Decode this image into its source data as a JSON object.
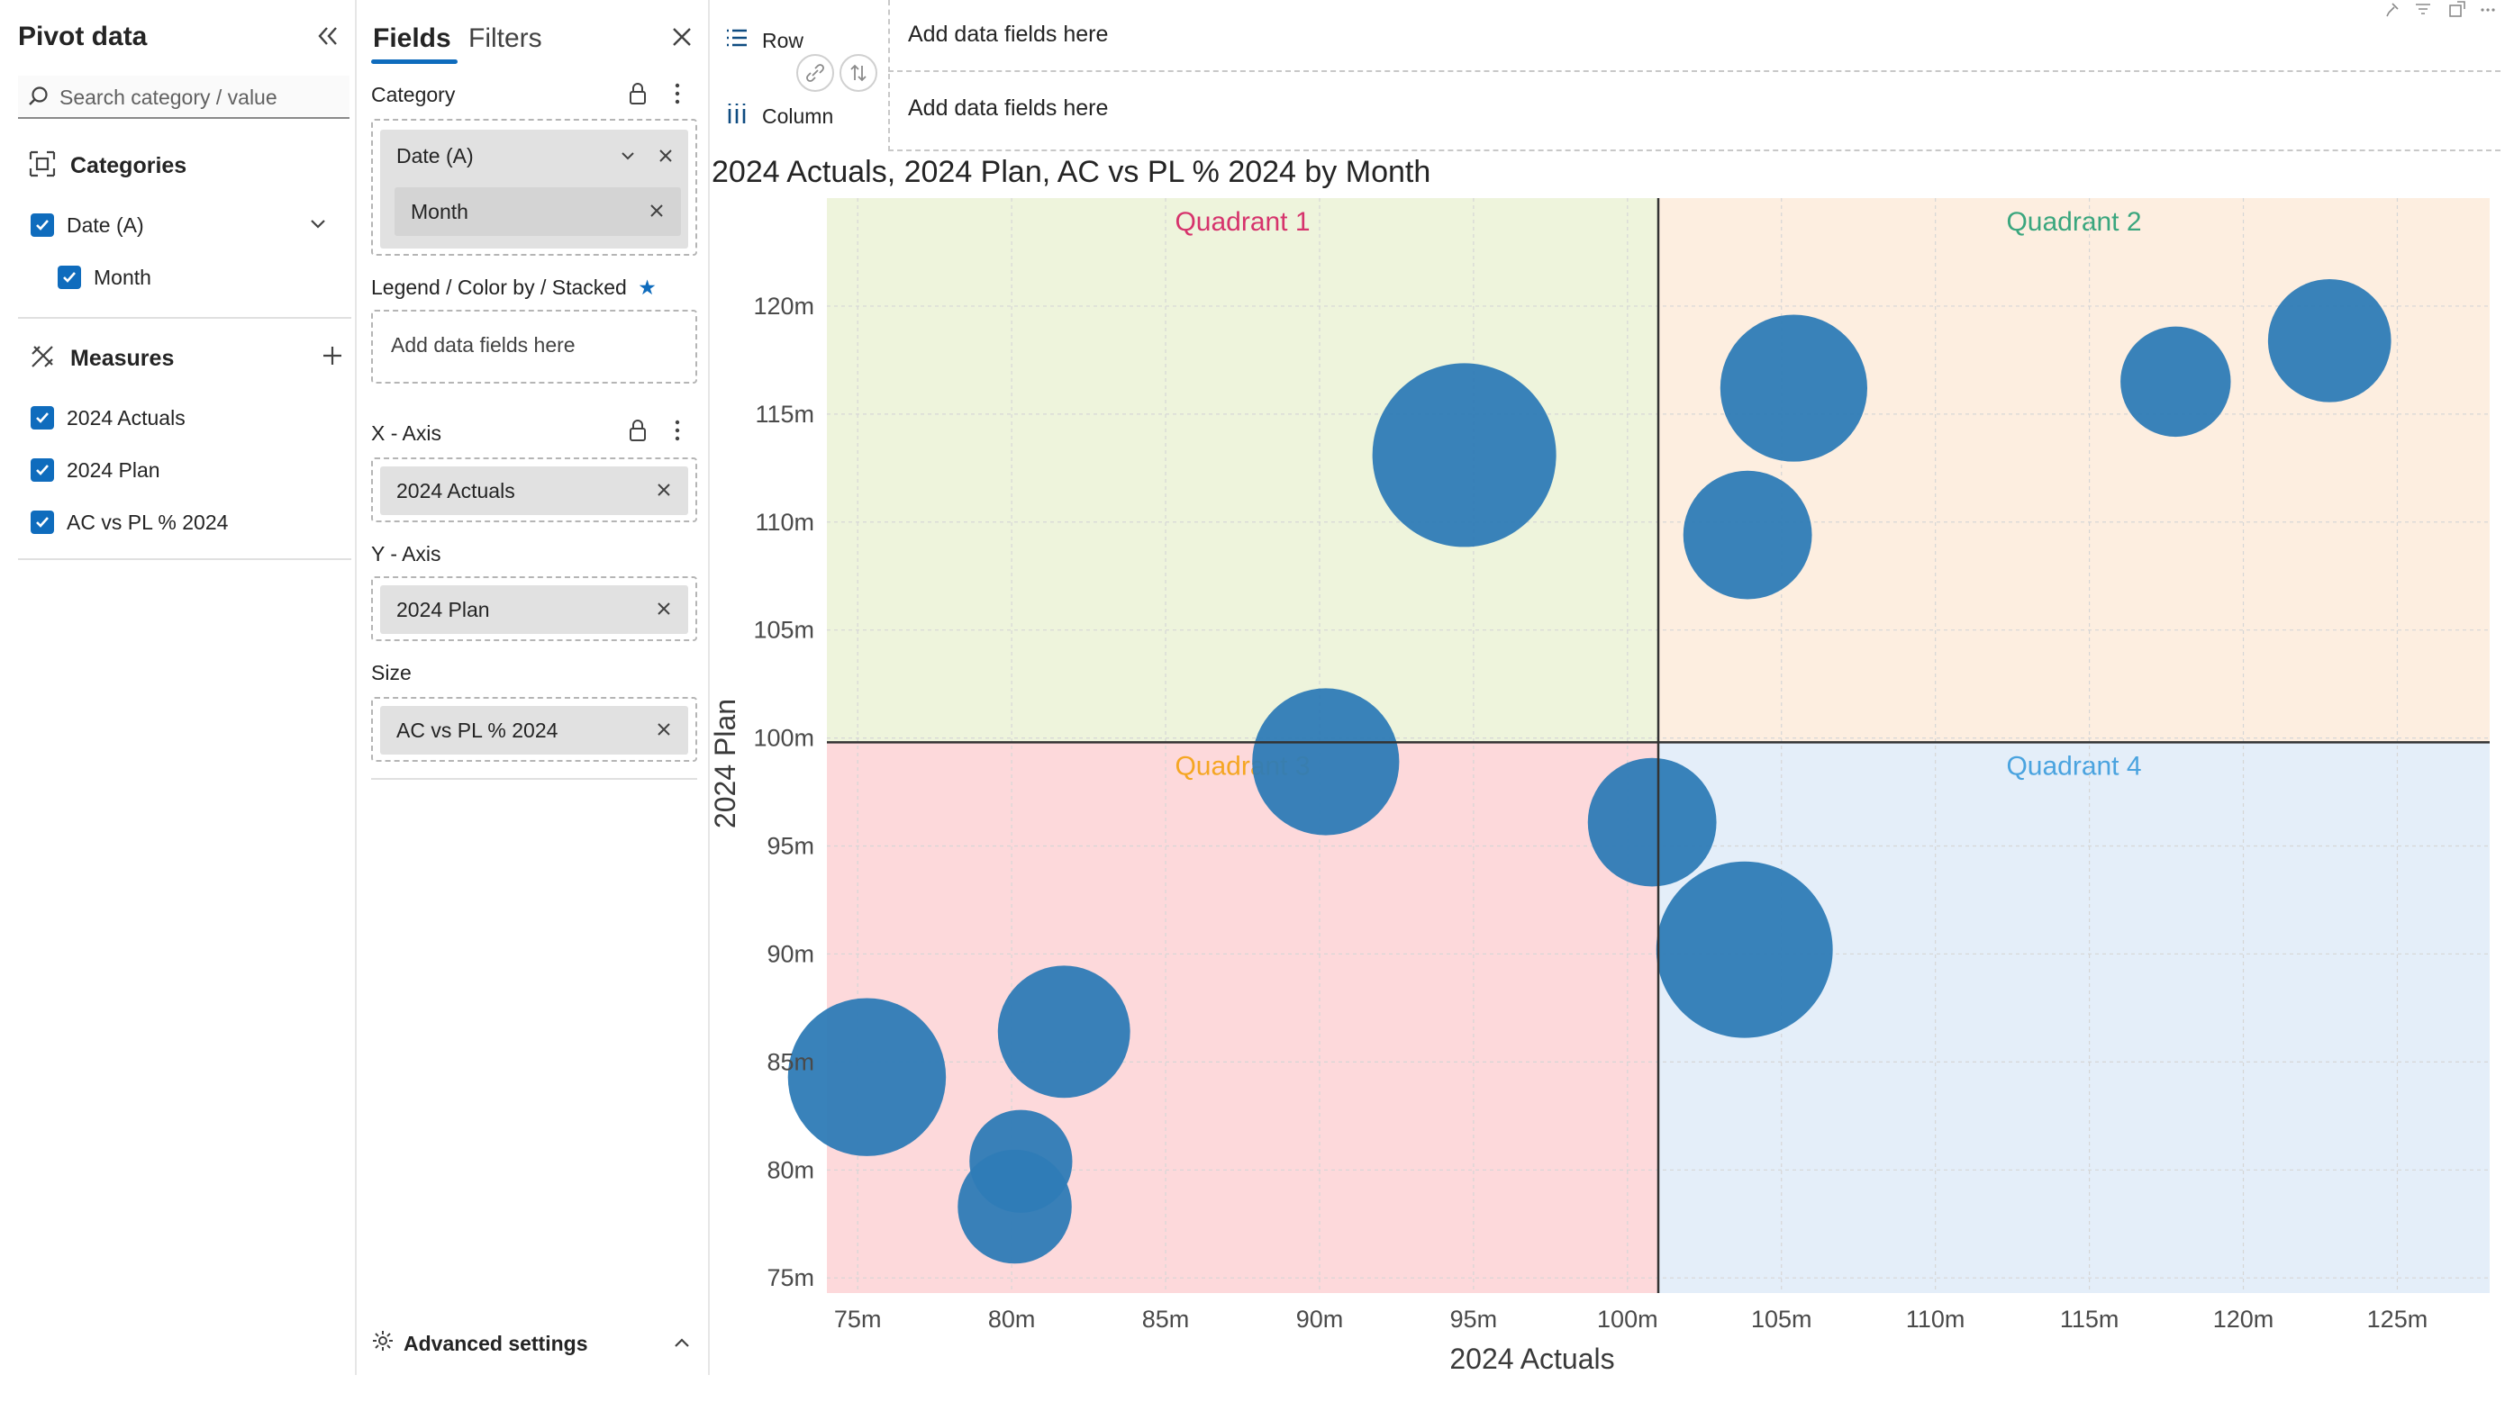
{
  "pivot": {
    "title": "Pivot data",
    "search_placeholder": "Search category / value",
    "categories_label": "Categories",
    "categories": [
      {
        "label": "Date (A)",
        "checked": true
      },
      {
        "label": "Month",
        "checked": true
      }
    ],
    "measures_label": "Measures",
    "measures": [
      {
        "label": "2024 Actuals",
        "checked": true
      },
      {
        "label": "2024 Plan",
        "checked": true
      },
      {
        "label": "AC vs PL % 2024",
        "checked": true
      }
    ]
  },
  "fields": {
    "tabs": [
      "Fields",
      "Filters"
    ],
    "category_label": "Category",
    "category_chip": "Date (A)",
    "category_subchip": "Month",
    "legend_label": "Legend / Color by / Stacked",
    "legend_placeholder": "Add data fields here",
    "xaxis_label": "X - Axis",
    "xaxis_chip": "2024 Actuals",
    "yaxis_label": "Y - Axis",
    "yaxis_chip": "2024 Plan",
    "size_label": "Size",
    "size_chip": "AC vs PL % 2024",
    "advanced_label": "Advanced settings"
  },
  "rowcol": {
    "row_label": "Row",
    "column_label": "Column",
    "row_placeholder": "Add data fields here",
    "column_placeholder": "Add data fields here"
  },
  "colors": {
    "accent": "#0f6cbd",
    "bubble": "#2e7bb6",
    "q1_bg": "#eef4dc",
    "q2_bg": "#fdeee0",
    "q3_bg": "#fdd9db",
    "q4_bg": "#e4eef9",
    "q1_label": "#d6336c",
    "q2_label": "#3aa67e",
    "q3_label": "#f5a623",
    "q4_label": "#4aa3df"
  },
  "chart_data": {
    "type": "scatter",
    "title": "2024 Actuals, 2024 Plan, AC vs PL % 2024 by Month",
    "xlabel": "2024 Actuals",
    "ylabel": "2024 Plan",
    "xlim": [
      74,
      128
    ],
    "ylim": [
      74.3,
      125
    ],
    "xticks": [
      {
        "value": 75,
        "label": "75m"
      },
      {
        "value": 80,
        "label": "80m"
      },
      {
        "value": 85,
        "label": "85m"
      },
      {
        "value": 90,
        "label": "90m"
      },
      {
        "value": 95,
        "label": "95m"
      },
      {
        "value": 100,
        "label": "100m"
      },
      {
        "value": 105,
        "label": "105m"
      },
      {
        "value": 110,
        "label": "110m"
      },
      {
        "value": 115,
        "label": "115m"
      },
      {
        "value": 120,
        "label": "120m"
      },
      {
        "value": 125,
        "label": "125m"
      }
    ],
    "yticks": [
      {
        "value": 75,
        "label": "75m"
      },
      {
        "value": 80,
        "label": "80m"
      },
      {
        "value": 85,
        "label": "85m"
      },
      {
        "value": 90,
        "label": "90m"
      },
      {
        "value": 95,
        "label": "95m"
      },
      {
        "value": 100,
        "label": "100m"
      },
      {
        "value": 105,
        "label": "105m"
      },
      {
        "value": 110,
        "label": "110m"
      },
      {
        "value": 115,
        "label": "115m"
      },
      {
        "value": 120,
        "label": "120m"
      }
    ],
    "quadrant_divider": {
      "x": 101,
      "y": 99.8
    },
    "quadrants": [
      "Quadrant 1",
      "Quadrant 2",
      "Quadrant 3",
      "Quadrant 4"
    ],
    "grid": true,
    "points": [
      {
        "x": 94.7,
        "y": 113.1,
        "size": 1.0
      },
      {
        "x": 105.4,
        "y": 116.2,
        "size": 0.8
      },
      {
        "x": 103.9,
        "y": 109.4,
        "size": 0.7
      },
      {
        "x": 117.8,
        "y": 116.5,
        "size": 0.6
      },
      {
        "x": 122.8,
        "y": 118.4,
        "size": 0.67
      },
      {
        "x": 90.2,
        "y": 98.9,
        "size": 0.8
      },
      {
        "x": 100.8,
        "y": 96.1,
        "size": 0.7
      },
      {
        "x": 103.8,
        "y": 90.2,
        "size": 0.96
      },
      {
        "x": 75.3,
        "y": 84.3,
        "size": 0.86
      },
      {
        "x": 81.7,
        "y": 86.4,
        "size": 0.72
      },
      {
        "x": 80.3,
        "y": 80.4,
        "size": 0.56
      },
      {
        "x": 80.1,
        "y": 78.3,
        "size": 0.62
      }
    ]
  }
}
